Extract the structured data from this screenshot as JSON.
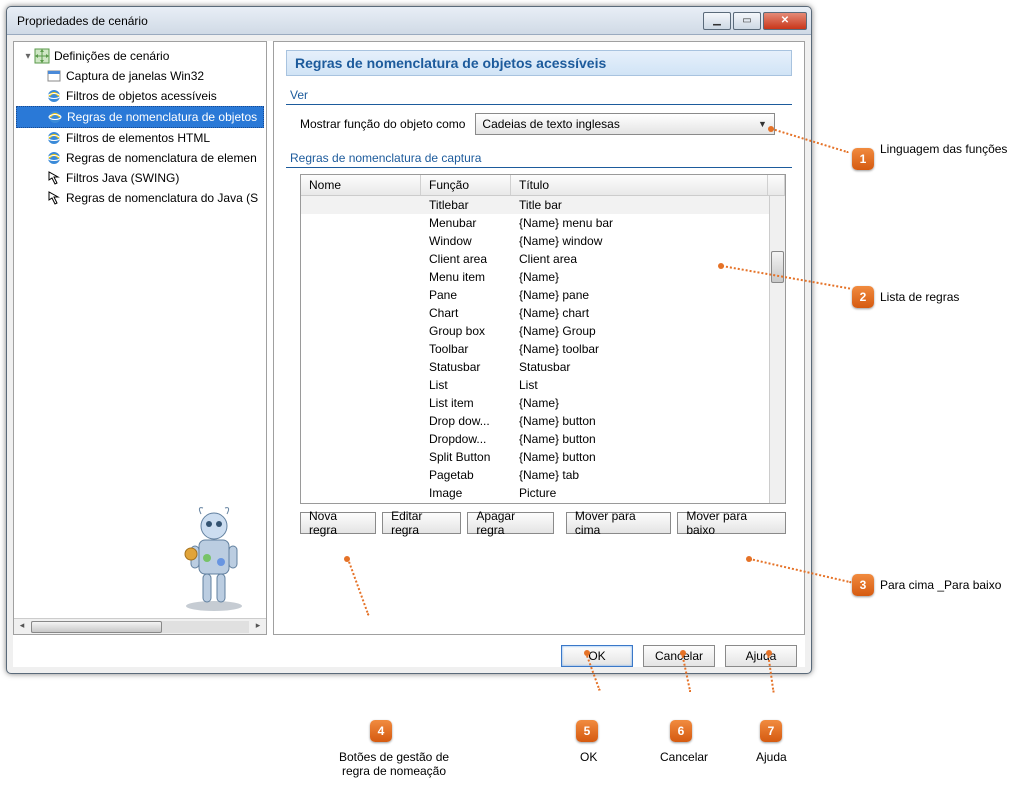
{
  "window": {
    "title": "Propriedades de cenário"
  },
  "tree": {
    "root": "Definições de cenário",
    "items": [
      "Captura de janelas Win32",
      "Filtros de objetos acessíveis",
      "Regras de nomenclatura de objetos",
      "Filtros de elementos HTML",
      "Regras de nomenclatura de elemen",
      "Filtros Java (SWING)",
      "Regras de nomenclatura do Java (S"
    ],
    "selected_index": 2
  },
  "main": {
    "title": "Regras de nomenclatura de objetos acessíveis",
    "ver": "Ver",
    "show_label": "Mostrar função do objeto como",
    "dropdown_value": "Cadeias de texto inglesas",
    "rules_header": "Regras de nomenclatura de captura",
    "columns": {
      "nome": "Nome",
      "funcao": "Função",
      "titulo": "Título"
    },
    "rows": [
      {
        "nome": "",
        "funcao": "Titlebar",
        "titulo": "Title bar"
      },
      {
        "nome": "",
        "funcao": "Menubar",
        "titulo": "{Name} menu bar"
      },
      {
        "nome": "",
        "funcao": "Window",
        "titulo": "{Name} window"
      },
      {
        "nome": "",
        "funcao": "Client area",
        "titulo": "Client area"
      },
      {
        "nome": "",
        "funcao": "Menu item",
        "titulo": "{Name}"
      },
      {
        "nome": "",
        "funcao": "Pane",
        "titulo": "{Name} pane"
      },
      {
        "nome": "",
        "funcao": "Chart",
        "titulo": "{Name} chart"
      },
      {
        "nome": "",
        "funcao": "Group box",
        "titulo": "{Name} Group"
      },
      {
        "nome": "",
        "funcao": "Toolbar",
        "titulo": "{Name} toolbar"
      },
      {
        "nome": "",
        "funcao": "Statusbar",
        "titulo": "Statusbar"
      },
      {
        "nome": "",
        "funcao": "List",
        "titulo": "List"
      },
      {
        "nome": "",
        "funcao": "List item",
        "titulo": "{Name}"
      },
      {
        "nome": "",
        "funcao": "Drop dow...",
        "titulo": "{Name} button"
      },
      {
        "nome": "",
        "funcao": "Dropdow...",
        "titulo": "{Name} button"
      },
      {
        "nome": "",
        "funcao": "Split Button",
        "titulo": "{Name} button"
      },
      {
        "nome": "",
        "funcao": "Pagetab",
        "titulo": "{Name} tab"
      },
      {
        "nome": "",
        "funcao": "Image",
        "titulo": "Picture"
      }
    ],
    "buttons": {
      "new": "Nova regra",
      "edit": "Editar regra",
      "delete": "Apagar regra",
      "up": "Mover para cima",
      "down": "Mover para baixo"
    }
  },
  "dialog_buttons": {
    "ok": "OK",
    "cancel": "Cancelar",
    "help": "Ajuda"
  },
  "callouts": {
    "c1": {
      "num": "1",
      "label": "Linguagem das funções"
    },
    "c2": {
      "num": "2",
      "label": "Lista de regras"
    },
    "c3": {
      "num": "3",
      "label": "Para cima _Para baixo"
    },
    "c4": {
      "num": "4",
      "label": "Botões de gestão de regra de nomeação"
    },
    "c5": {
      "num": "5",
      "label": "OK"
    },
    "c6": {
      "num": "6",
      "label": "Cancelar"
    },
    "c7": {
      "num": "7",
      "label": "Ajuda"
    }
  }
}
